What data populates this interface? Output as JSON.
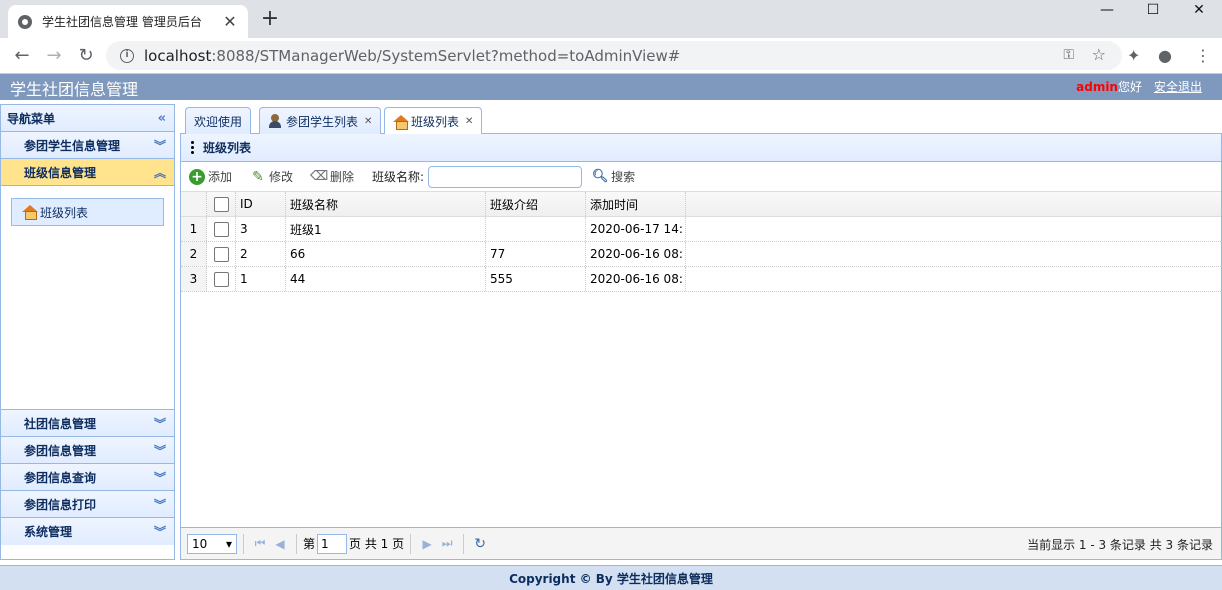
{
  "browser": {
    "tab_title": "学生社团信息管理 管理员后台",
    "url_host": "localhost",
    "url_rest": ":8088/STManagerWeb/SystemServlet?method=toAdminView#"
  },
  "header": {
    "title": "学生社团信息管理",
    "username": "admin",
    "greeting": "您好",
    "logout": "安全退出"
  },
  "sidebar": {
    "title": "导航菜单",
    "sections": [
      {
        "label": "参团学生信息管理"
      },
      {
        "label": "班级信息管理"
      },
      {
        "label": "社团信息管理"
      },
      {
        "label": "参团信息管理"
      },
      {
        "label": "参团信息查询"
      },
      {
        "label": "参团信息打印"
      },
      {
        "label": "系统管理"
      }
    ],
    "active_item": "班级列表"
  },
  "tabs": [
    {
      "label": "欢迎使用"
    },
    {
      "label": "参团学生列表"
    },
    {
      "label": "班级列表"
    }
  ],
  "panel": {
    "title": "班级列表",
    "toolbar": {
      "add": "添加",
      "edit": "修改",
      "delete": "删除",
      "search_label": "班级名称:",
      "search_value": "",
      "search": "搜索"
    },
    "columns": [
      "ID",
      "班级名称",
      "班级介绍",
      "添加时间"
    ],
    "rows": [
      {
        "num": "1",
        "id": "3",
        "name": "班级1",
        "info": "",
        "time": "2020-06-17 14:"
      },
      {
        "num": "2",
        "id": "2",
        "name": "66",
        "info": "77",
        "time": "2020-06-16 08:"
      },
      {
        "num": "3",
        "id": "1",
        "name": "44",
        "info": "555",
        "time": "2020-06-16 08:"
      }
    ],
    "pager": {
      "page_size": "10",
      "page_prefix": "第",
      "page_value": "1",
      "page_suffix": "页 共 1 页",
      "info": "当前显示 1 - 3 条记录 共 3 条记录"
    }
  },
  "footer": "Copyright © By 学生社团信息管理"
}
